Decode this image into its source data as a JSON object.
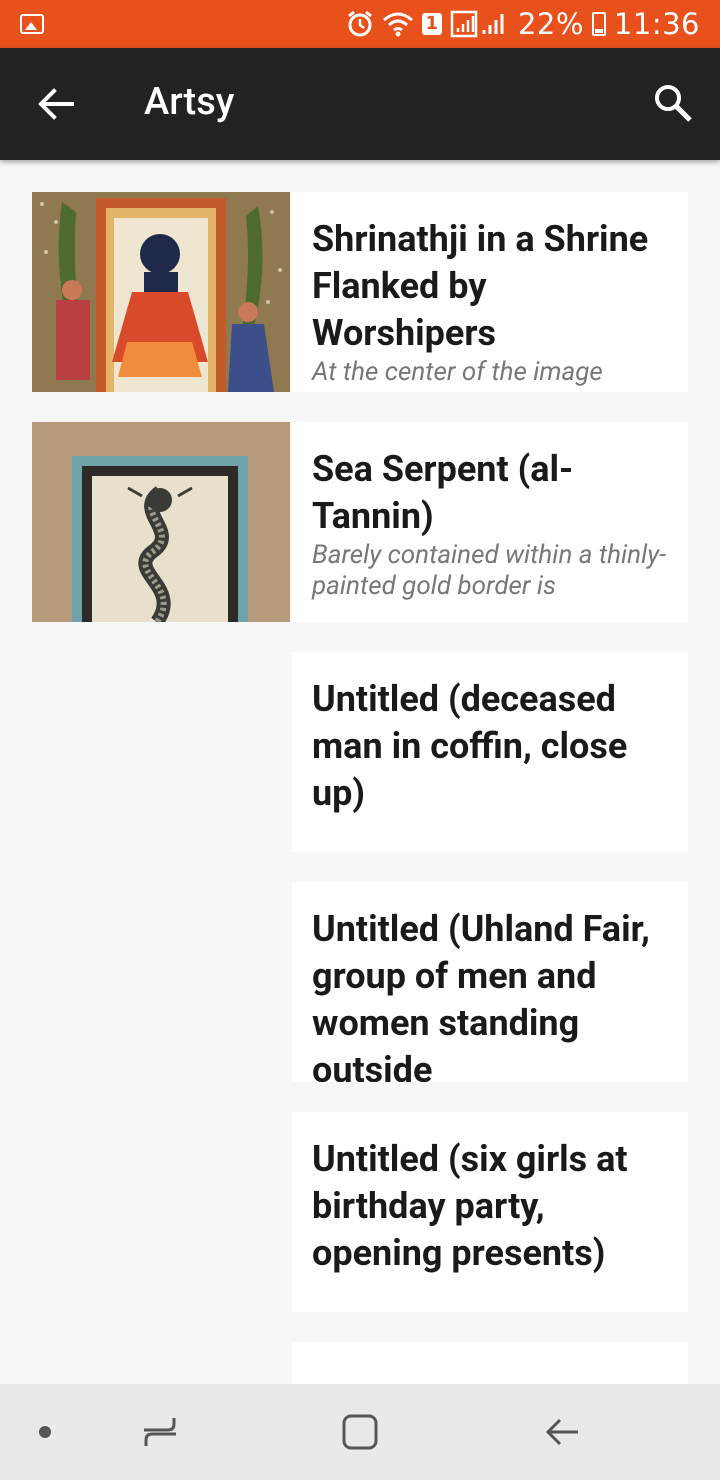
{
  "status_bar": {
    "battery": "22%",
    "time": "11:36",
    "sim_badge": "1",
    "icons": [
      "gallery-icon",
      "alarm-icon",
      "wifi-icon",
      "signal-icon",
      "battery-icon"
    ]
  },
  "app_bar": {
    "title": "Artsy",
    "back_icon": "arrow-left-icon",
    "search_icon": "search-icon",
    "background": "#222222"
  },
  "accent": "#e8501c",
  "cards": [
    {
      "title": "Shrinathji in a Shrine Flanked by Worshipers",
      "description": "At the center of the image",
      "has_thumbnail": true
    },
    {
      "title": "Sea Serpent (al-Tannin)",
      "description": "Barely contained within a thinly-painted gold border is",
      "has_thumbnail": true
    },
    {
      "title": "Untitled (deceased man in coffin, close up)",
      "description": "",
      "has_thumbnail": false
    },
    {
      "title": "Untitled (Uhland Fair, group of men and women standing outside",
      "description": "",
      "has_thumbnail": false
    },
    {
      "title": "Untitled (six girls at birthday party, opening presents)",
      "description": "",
      "has_thumbnail": false
    }
  ],
  "nav_bar": {
    "items": [
      "dot-icon",
      "recent-apps-icon",
      "home-icon",
      "back-icon"
    ]
  }
}
